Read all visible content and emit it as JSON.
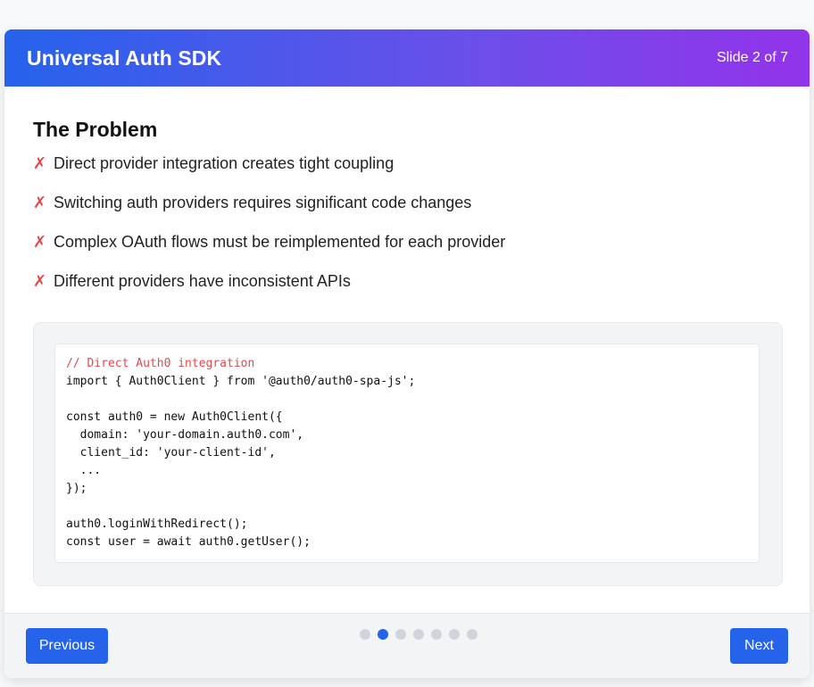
{
  "header": {
    "title": "Universal Auth SDK",
    "slide_counter": "Slide 2 of 7"
  },
  "slide": {
    "heading": "The Problem",
    "bullet_mark": "✗",
    "bullets": [
      "Direct provider integration creates tight coupling",
      "Switching auth providers requires significant code changes",
      "Complex OAuth flows must be reimplemented for each provider",
      "Different providers have inconsistent APIs"
    ],
    "code_lines": [
      "// Direct Auth0 integration",
      "import { Auth0Client } from '@auth0/auth0-spa-js';",
      "",
      "const auth0 = new Auth0Client({",
      "  domain: 'your-domain.auth0.com',",
      "  client_id: 'your-client-id',",
      "  ...",
      "});",
      "",
      "auth0.loginWithRedirect();",
      "const user = await auth0.getUser();"
    ]
  },
  "footer": {
    "prev_label": "Previous",
    "next_label": "Next",
    "total_slides": 7,
    "active_slide": 2
  },
  "colors": {
    "accent": "#2563eb",
    "header_gradient_start": "#2563eb",
    "header_gradient_end": "#9333ea",
    "bullet_mark": "#ef4444",
    "code_comment": "#e5484d"
  }
}
